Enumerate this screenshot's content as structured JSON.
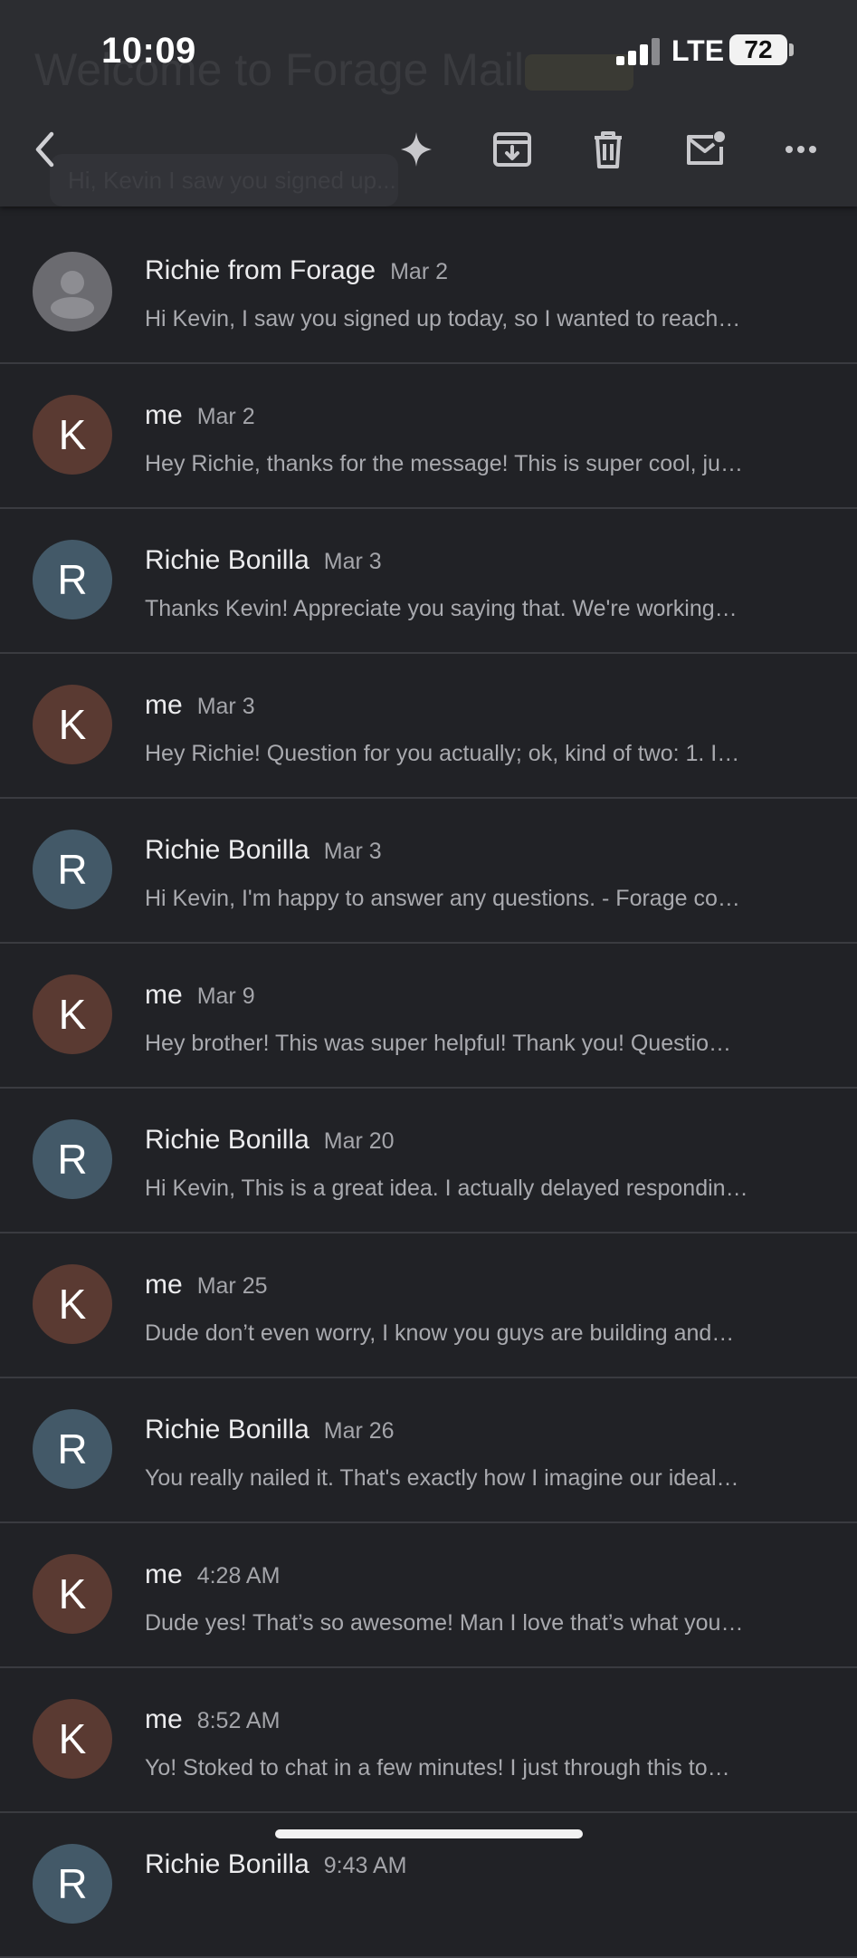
{
  "status_bar": {
    "time": "10:09",
    "network": "LTE",
    "battery": "72"
  },
  "header": {
    "ghost_title": "Welcome to Forage Mail",
    "ghost_chip": "Hi, Kevin I saw you signed up..."
  },
  "toolbar": {
    "back": "chevron-left-icon",
    "ai": "sparkle-icon",
    "archive": "archive-icon",
    "delete": "trash-icon",
    "unread": "mark-unread-icon",
    "more": "more-icon"
  },
  "colors": {
    "me_avatar": "#5a3a32",
    "richie_avatar": "#435968",
    "forage_avatar": "#6b6b70"
  },
  "messages": [
    {
      "avatar": "",
      "sender": "Richie from Forage",
      "date": "Mar 2",
      "preview": "Hi Kevin, I saw you signed up today, so I wanted to reach…"
    },
    {
      "avatar": "K",
      "sender": "me",
      "date": "Mar 2",
      "preview": "Hey Richie, thanks for the message! This is super cool, ju…"
    },
    {
      "avatar": "R",
      "sender": "Richie Bonilla",
      "date": "Mar 3",
      "preview": "Thanks Kevin! Appreciate you saying that. We're working…"
    },
    {
      "avatar": "K",
      "sender": "me",
      "date": "Mar 3",
      "preview": "Hey Richie! Question for you actually; ok, kind of two: 1. I…"
    },
    {
      "avatar": "R",
      "sender": "Richie Bonilla",
      "date": "Mar 3",
      "preview": "Hi Kevin, I'm happy to answer any questions. - Forage co…"
    },
    {
      "avatar": "K",
      "sender": "me",
      "date": "Mar 9",
      "preview": "Hey brother! This was super helpful! Thank you! Questio…"
    },
    {
      "avatar": "R",
      "sender": "Richie Bonilla",
      "date": "Mar 20",
      "preview": "Hi Kevin, This is a great idea. I actually delayed respondin…"
    },
    {
      "avatar": "K",
      "sender": "me",
      "date": "Mar 25",
      "preview": "Dude don’t even worry, I know you guys are building and…"
    },
    {
      "avatar": "R",
      "sender": "Richie Bonilla",
      "date": "Mar 26",
      "preview": "You really nailed it. That's exactly how I imagine our ideal…"
    },
    {
      "avatar": "K",
      "sender": "me",
      "date": "4:28 AM",
      "preview": "Dude yes! That’s so awesome! Man I love that’s what you…"
    },
    {
      "avatar": "K",
      "sender": "me",
      "date": "8:52 AM",
      "preview": "Yo! Stoked to chat in a few minutes! I just through this to…"
    },
    {
      "avatar": "R",
      "sender": "Richie Bonilla",
      "date": "9:43 AM",
      "preview": ""
    }
  ]
}
